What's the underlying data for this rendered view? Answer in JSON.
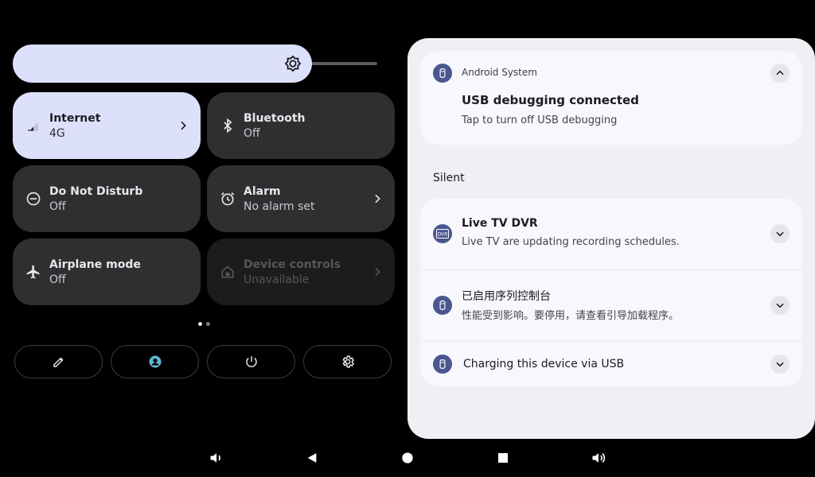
{
  "quick_settings": {
    "brightness": {
      "level": 0.8
    },
    "tiles": [
      {
        "id": "internet",
        "title": "Internet",
        "subtitle": "4G",
        "state": "active",
        "icon": "signal-icon",
        "has_chevron": true
      },
      {
        "id": "bluetooth",
        "title": "Bluetooth",
        "subtitle": "Off",
        "state": "off",
        "icon": "bluetooth-icon",
        "has_chevron": false
      },
      {
        "id": "dnd",
        "title": "Do Not Disturb",
        "subtitle": "Off",
        "state": "off",
        "icon": "do-not-disturb-icon",
        "has_chevron": false
      },
      {
        "id": "alarm",
        "title": "Alarm",
        "subtitle": "No alarm set",
        "state": "off",
        "icon": "alarm-icon",
        "has_chevron": true
      },
      {
        "id": "airplane",
        "title": "Airplane mode",
        "subtitle": "Off",
        "state": "off",
        "icon": "airplane-icon",
        "has_chevron": false
      },
      {
        "id": "device-controls",
        "title": "Device controls",
        "subtitle": "Unavailable",
        "state": "disabled",
        "icon": "home-icon",
        "has_chevron": true
      }
    ],
    "pager": {
      "pages": 2,
      "current": 1
    },
    "bottom_buttons": [
      "edit-icon",
      "user-icon",
      "power-icon",
      "settings-icon"
    ]
  },
  "notifications": {
    "alerting": {
      "app_name": "Android System",
      "title": "USB debugging connected",
      "text": "Tap to turn off USB debugging",
      "icon": "usb-icon",
      "expanded": true
    },
    "silent_header": "Silent",
    "silent": [
      {
        "title": "Live TV DVR",
        "text": "Live TV are updating recording schedules.",
        "icon": "dvr-icon"
      },
      {
        "title": "已启用序列控制台",
        "text": "性能受到影响。要停用，请查看引导加载程序。",
        "icon": "usb-icon"
      },
      {
        "title": "Charging this device via USB",
        "text": "",
        "icon": "usb-icon"
      }
    ]
  },
  "nav_bar": [
    "volume-down-icon",
    "back-icon",
    "home-icon",
    "recents-icon",
    "volume-up-icon"
  ],
  "colors": {
    "accent_tile": "#dde0fb",
    "tile_off": "#2f2f32",
    "panel": "#f0eff3",
    "notif_icon": "#4a5690"
  }
}
